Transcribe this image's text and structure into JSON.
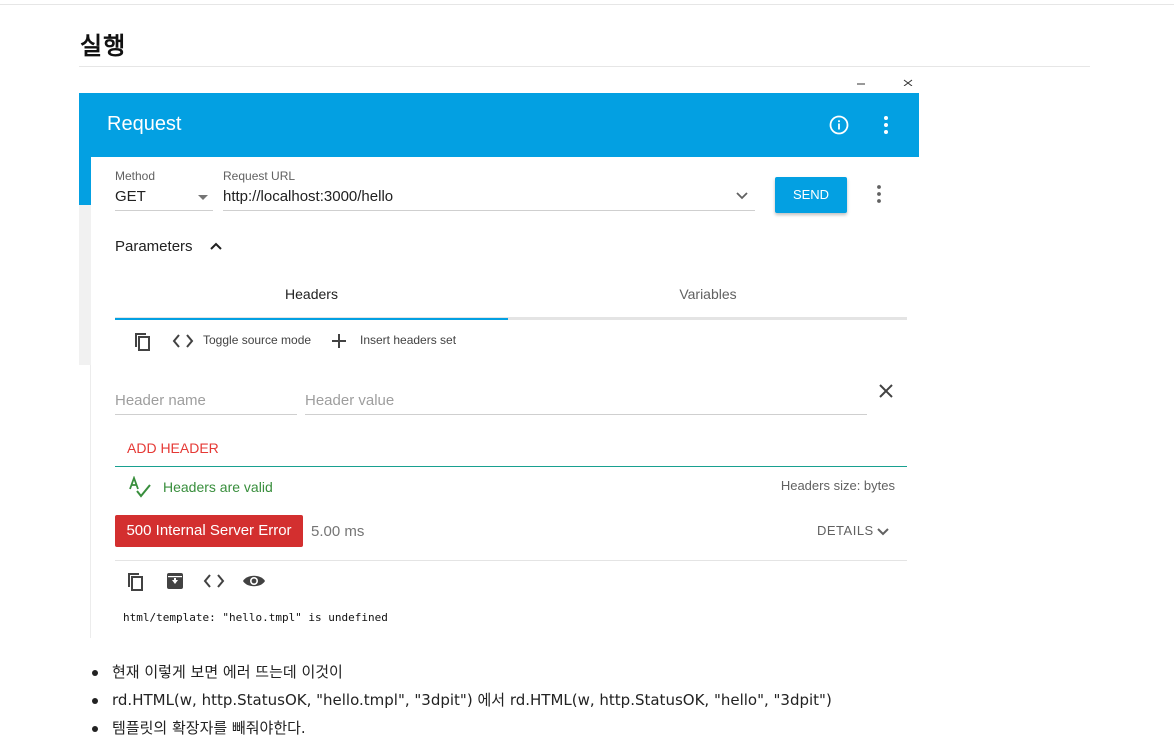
{
  "page": {
    "heading": "실행",
    "bullets": [
      "현재 이렇게 보면 에러 뜨는데 이것이",
      "rd.HTML(w, http.StatusOK, \"hello.tmpl\", \"3dpit\") 에서 rd.HTML(w, http.StatusOK, \"hello\", \"3dpit\")",
      "템플릿의 확장자를 빼줘야한다."
    ]
  },
  "app": {
    "title": "Request",
    "accent": "#03a0e2",
    "error_color": "#d32f2f",
    "valid_color": "#388e3c"
  },
  "request": {
    "method_label": "Method",
    "method_value": "GET",
    "url_label": "Request URL",
    "url_value": "http://localhost:3000/hello",
    "send_label": "SEND"
  },
  "params": {
    "title": "Parameters",
    "tabs": [
      {
        "label": "Headers",
        "active": true
      },
      {
        "label": "Variables",
        "active": false
      }
    ],
    "toolbar": {
      "toggle_source": "Toggle source mode",
      "insert_set": "Insert headers set"
    },
    "header_name_placeholder": "Header name",
    "header_value_placeholder": "Header value",
    "add_header": "ADD HEADER",
    "valid_text": "Headers are valid",
    "size_text": "Headers size: bytes"
  },
  "response": {
    "status": "500 Internal Server Error",
    "time": "5.00 ms",
    "details": "DETAILS",
    "body": "html/template: \"hello.tmpl\" is undefined"
  },
  "icons": {
    "info": "info-icon",
    "more": "more-vert-icon",
    "copy": "copy-icon",
    "code": "code-icon",
    "add": "plus-icon",
    "close": "close-icon",
    "spellcheck": "spellcheck-icon",
    "chevron": "chevron-down-icon",
    "archive": "archive-icon",
    "eye": "eye-icon"
  }
}
